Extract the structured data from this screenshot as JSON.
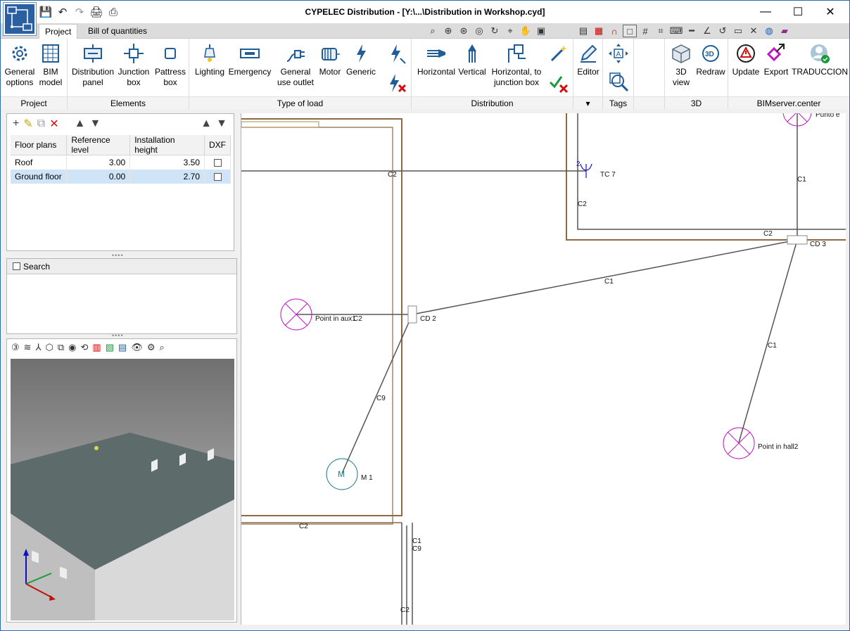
{
  "window": {
    "title": "CYPELEC Distribution - [Y:\\...\\Distribution in Workshop.cyd]",
    "minimize_glyph": "—",
    "maximize_glyph": "☐",
    "close_glyph": "✕"
  },
  "quick_access": {
    "save_icon": "save-icon",
    "undo_icon": "undo-icon",
    "redo_icon": "redo-icon",
    "print_icon": "print-icon",
    "print_preview_icon": "print-preview-icon"
  },
  "tabs": [
    {
      "label": "Project",
      "active": true
    },
    {
      "label": "Bill of quantities",
      "active": false
    }
  ],
  "ribbon": {
    "groups": [
      {
        "label": "Project",
        "buttons": [
          {
            "label": "General options",
            "icon": "gear-icon"
          },
          {
            "label": "BIM model",
            "icon": "table-icon"
          }
        ]
      },
      {
        "label": "Elements",
        "buttons": [
          {
            "label": "Distribution panel",
            "icon": "panel-icon"
          },
          {
            "label": "Junction box",
            "icon": "junction-box-icon"
          },
          {
            "label": "Pattress box",
            "icon": "pattress-box-icon"
          }
        ]
      },
      {
        "label": "Type of load",
        "buttons": [
          {
            "label": "Lighting",
            "icon": "lighting-icon"
          },
          {
            "label": "Emergency",
            "icon": "emergency-icon"
          },
          {
            "label": "General use outlet",
            "icon": "outlet-icon"
          },
          {
            "label": "Motor",
            "icon": "motor-icon"
          },
          {
            "label": "Generic",
            "icon": "generic-load-icon"
          }
        ]
      },
      {
        "label": "Distribution",
        "buttons": [
          {
            "label": "Horizontal",
            "icon": "horizontal-icon"
          },
          {
            "label": "Vertical",
            "icon": "vertical-icon"
          },
          {
            "label": "Horizontal, to junction box",
            "icon": "horizontal-junction-icon"
          }
        ]
      },
      {
        "label": "",
        "buttons": [
          {
            "label": "Editor",
            "icon": "pencil-icon"
          }
        ]
      },
      {
        "label": "Tags",
        "buttons": []
      },
      {
        "label": "3D",
        "buttons": [
          {
            "label": "3D view",
            "icon": "cube-icon"
          },
          {
            "label": "Redraw",
            "icon": "redraw-icon"
          }
        ]
      },
      {
        "label": "BIMserver.center",
        "buttons": [
          {
            "label": "Update",
            "icon": "update-icon"
          },
          {
            "label": "Export",
            "icon": "export-icon"
          },
          {
            "label": "TRADUCCION",
            "icon": "user-icon"
          }
        ]
      }
    ]
  },
  "floor_plans": {
    "columns": [
      "Floor plans",
      "Reference level",
      "Installation height",
      "DXF"
    ],
    "rows": [
      {
        "name": "Roof",
        "reference_level": "3.00",
        "installation_height": "3.50",
        "dxf": false,
        "selected": false
      },
      {
        "name": "Ground floor",
        "reference_level": "0.00",
        "installation_height": "2.70",
        "dxf": false,
        "selected": true
      }
    ]
  },
  "search": {
    "label": "Search",
    "checked": false
  },
  "drawing": {
    "labels": {
      "c2_top": "C2",
      "tc7": "TC 7",
      "c2_tc": "C2",
      "c1_top": "C1",
      "c2_cd3": "C2",
      "cd3": "CD 3",
      "c1_mid": "C1",
      "point_aux": "Point in aux1",
      "c2_aux": "C2",
      "cd2": "CD 2",
      "c1_right": "C1",
      "c9": "C9",
      "point_hall2": "Point in hall2",
      "m1": "M 1",
      "m_symbol": "M",
      "c2_bottom": "C2",
      "c1_vert": "C1",
      "c9_vert": "C9",
      "c2_vert": "C2",
      "punto": "Punto e",
      "tc_num": "2"
    },
    "colors": {
      "wall": "#8b6a45",
      "cable": "#555555",
      "lighting": "#c018c0",
      "motor": "#1f7d8c"
    }
  }
}
